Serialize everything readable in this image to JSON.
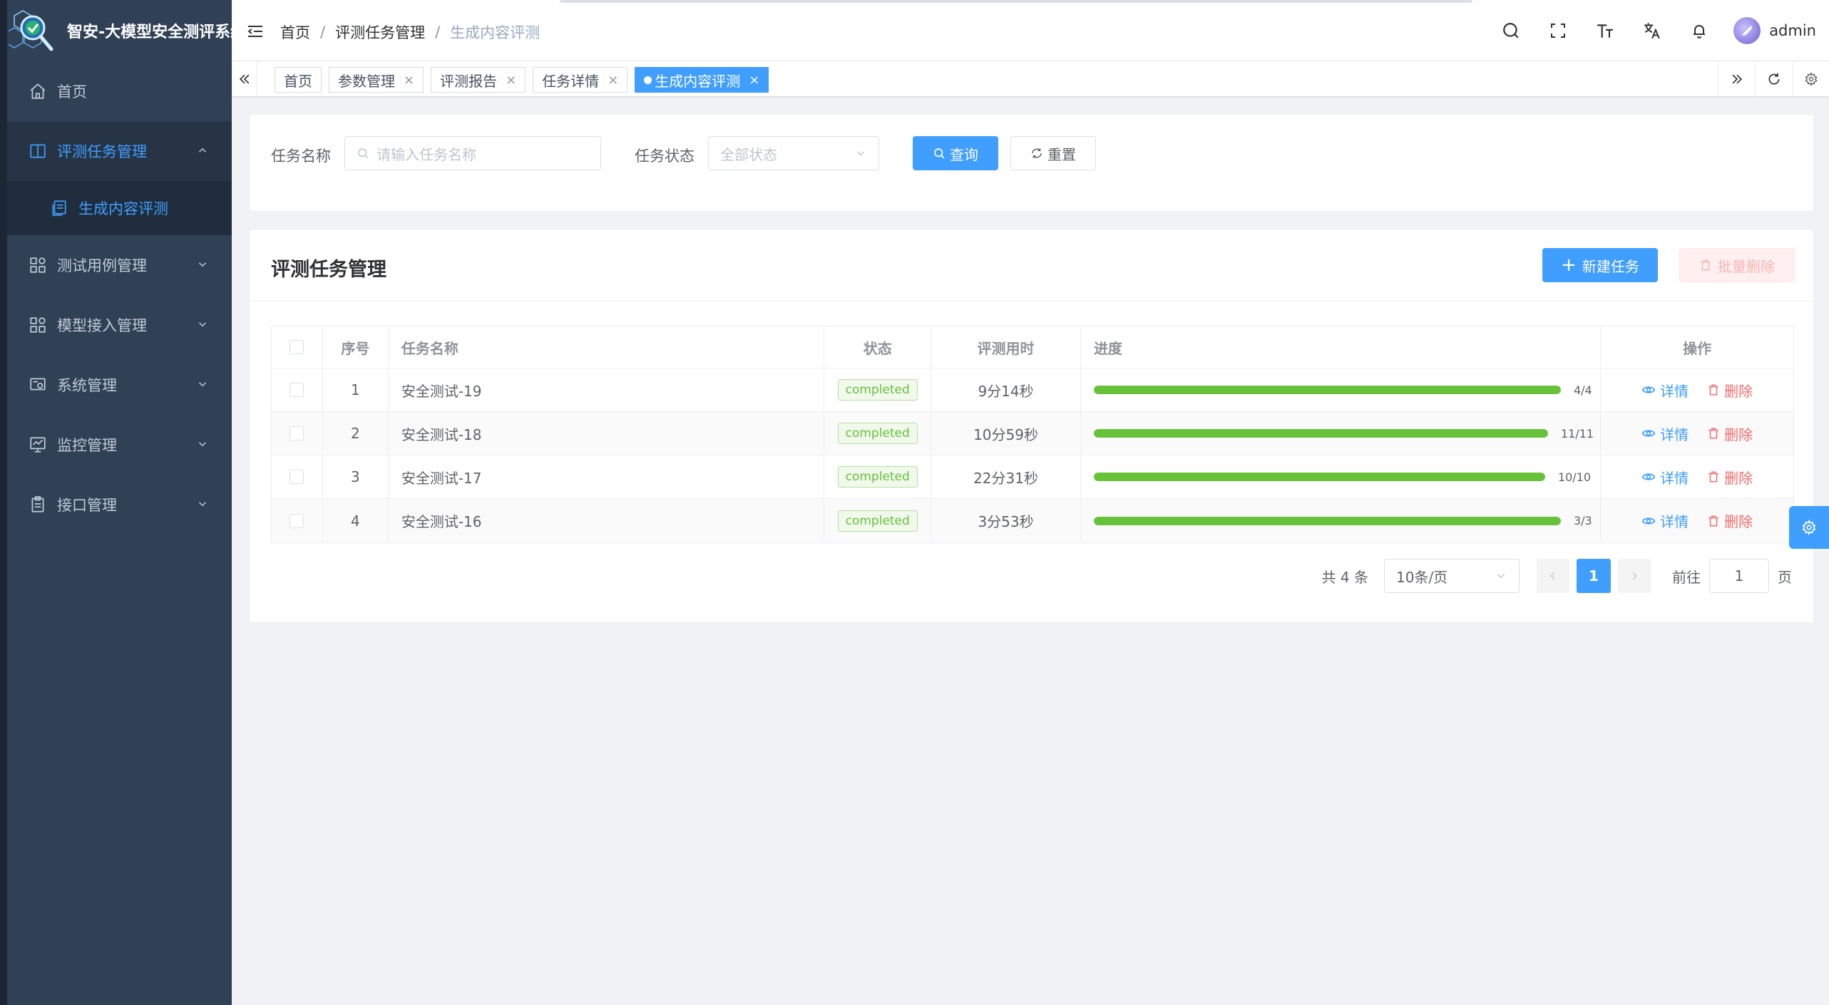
{
  "app": {
    "title": "智安-大模型安全测评系统"
  },
  "sidebar": {
    "items": [
      {
        "label": "首页",
        "icon": "home-icon"
      },
      {
        "label": "评测任务管理",
        "icon": "book-icon",
        "open": true
      },
      {
        "label": "测试用例管理",
        "icon": "grid-icon"
      },
      {
        "label": "模型接入管理",
        "icon": "grid-icon"
      },
      {
        "label": "系统管理",
        "icon": "system-icon"
      },
      {
        "label": "监控管理",
        "icon": "monitor-icon"
      },
      {
        "label": "接口管理",
        "icon": "clipboard-icon"
      }
    ],
    "sub_item": {
      "label": "生成内容评测",
      "icon": "document-icon"
    }
  },
  "navbar": {
    "breadcrumb": [
      "首页",
      "评测任务管理",
      "生成内容评测"
    ],
    "separator": "/",
    "username": "admin"
  },
  "tags": [
    {
      "label": "首页",
      "closable": false
    },
    {
      "label": "参数管理",
      "closable": true
    },
    {
      "label": "评测报告",
      "closable": true
    },
    {
      "label": "任务详情",
      "closable": true
    },
    {
      "label": "生成内容评测",
      "closable": true,
      "active": true
    }
  ],
  "tag_close": "×",
  "search": {
    "name_label": "任务名称",
    "name_placeholder": "请输入任务名称",
    "status_label": "任务状态",
    "status_placeholder": "全部状态",
    "query_button": "查询",
    "reset_button": "重置"
  },
  "list": {
    "title": "评测任务管理",
    "new_button": "新建任务",
    "batch_delete_button": "批量删除",
    "columns": [
      "序号",
      "任务名称",
      "状态",
      "评测用时",
      "进度",
      "操作"
    ],
    "rows": [
      {
        "no": "1",
        "name": "安全测试-19",
        "status": "completed",
        "duration": "9分14秒",
        "progress_text": "4/4",
        "progress": 1.0
      },
      {
        "no": "2",
        "name": "安全测试-18",
        "status": "completed",
        "duration": "10分59秒",
        "progress_text": "11/11",
        "progress": 1.0
      },
      {
        "no": "3",
        "name": "安全测试-17",
        "status": "completed",
        "duration": "22分31秒",
        "progress_text": "10/10",
        "progress": 1.0
      },
      {
        "no": "4",
        "name": "安全测试-16",
        "status": "completed",
        "duration": "3分53秒",
        "progress_text": "3/3",
        "progress": 1.0
      }
    ],
    "view_label": "详情",
    "delete_label": "删除"
  },
  "pagination": {
    "total": "共 4 条",
    "page_size": "10条/页",
    "current_page": "1",
    "goto_label": "前往",
    "goto_value": "1",
    "page_suffix": "页"
  },
  "colors": {
    "primary": "#409eff",
    "sidebar": "#304156",
    "success": "#67c23a",
    "danger": "#f56c6c"
  }
}
